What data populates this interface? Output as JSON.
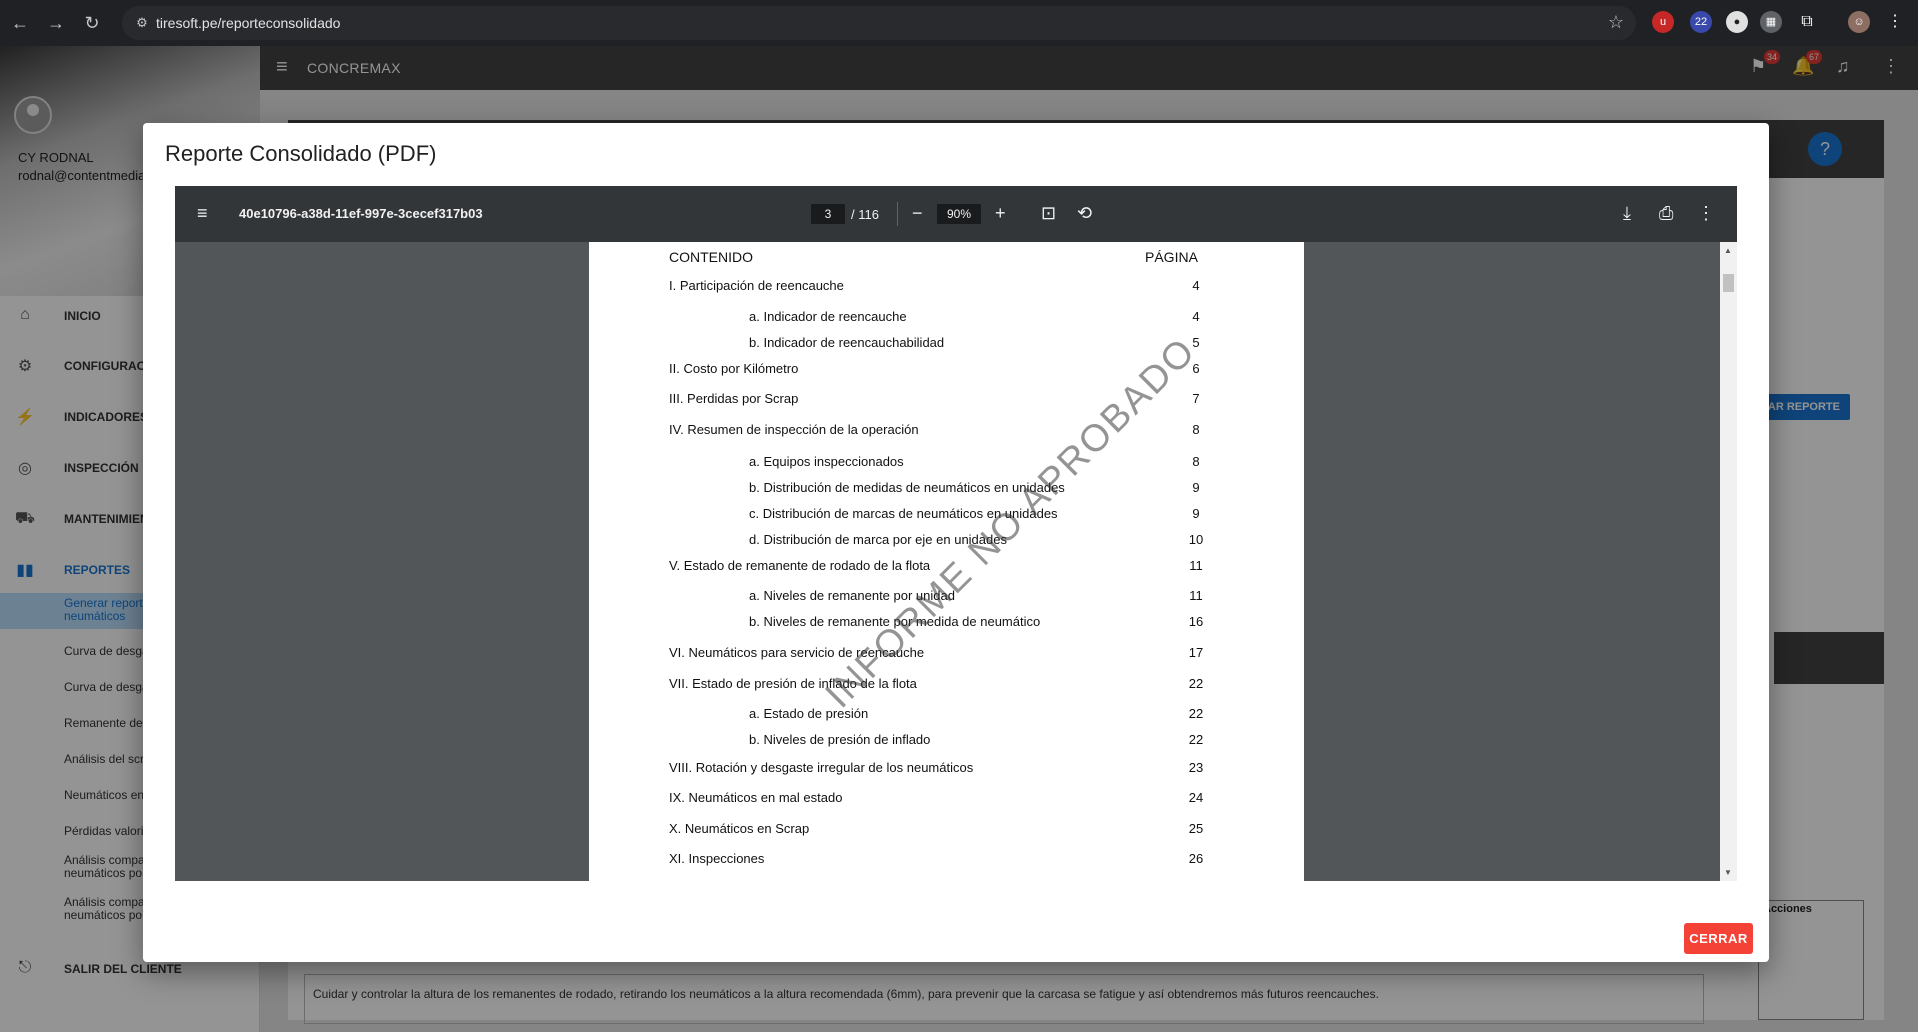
{
  "browser": {
    "url": "tiresoft.pe/reporteconsolidado",
    "ext_badges": {
      "notif_count": "22"
    }
  },
  "app": {
    "title": "CONCREMAX",
    "user": {
      "name": "CY RODNAL",
      "email": "rodnal@contentmedia."
    },
    "badges": {
      "flags": "34",
      "bell": "67"
    },
    "menu": [
      {
        "label": "INICIO",
        "icon": "home-icon"
      },
      {
        "label": "CONFIGURACIÓ",
        "icon": "gear-icon"
      },
      {
        "label": "INDICADORES",
        "icon": "indicators-icon"
      },
      {
        "label": "INSPECCIÓN",
        "icon": "inspection-icon"
      },
      {
        "label": "MANTENIMIEN",
        "icon": "maintenance-icon"
      },
      {
        "label": "REPORTES",
        "icon": "bar-chart-icon"
      }
    ],
    "submenu": [
      "Generar reporte\nneumáticos",
      "Curva de desga",
      "Curva de desga",
      "Remanente de",
      "Análisis del scr",
      "Neumáticos en",
      "Pérdidas valori",
      "Análisis compa\nneumáticos po",
      "Análisis compa\nneumáticos po"
    ],
    "exit_label": "SALIR DEL CLIENTE",
    "upload_label": "CARGAR REPORTE",
    "acciones_label": "Acciones",
    "note_text": "Cuidar y controlar la altura de los remanentes de rodado, retirando los neumáticos a la altura recomendada (6mm), para prevenir que la carcasa se fatigue y así obtendremos más futuros reencauches."
  },
  "modal": {
    "title": "Reporte Consolidado (PDF)",
    "close_label": "CERRAR"
  },
  "viewer": {
    "doc_name": "40e10796-a38d-11ef-997e-3cecef317b03",
    "current_page": "3",
    "total_pages": "/ 116",
    "zoom": "90%"
  },
  "toc": {
    "header_left": "CONTENIDO",
    "header_right": "PÁGINA",
    "watermark": "INFORME NO APROBADO",
    "entries": [
      {
        "title": "I. Participación de reencauche",
        "page": "4",
        "indent": false
      },
      {
        "title": "a. Indicador de reencauche",
        "page": "4",
        "indent": true
      },
      {
        "title": "b. Indicador de reencauchabilidad",
        "page": "5",
        "indent": true
      },
      {
        "title": "II. Costo por Kilómetro",
        "page": "6",
        "indent": false
      },
      {
        "title": "III. Perdidas por Scrap",
        "page": "7",
        "indent": false
      },
      {
        "title": "IV. Resumen de inspección de la operación",
        "page": "8",
        "indent": false
      },
      {
        "title": "a. Equipos inspeccionados",
        "page": "8",
        "indent": true
      },
      {
        "title": "b. Distribución de medidas de neumáticos en unidades",
        "page": "9",
        "indent": true
      },
      {
        "title": "c. Distribución de marcas de neumáticos en unidades",
        "page": "9",
        "indent": true
      },
      {
        "title": "d. Distribución de marca por eje en unidades",
        "page": "10",
        "indent": true
      },
      {
        "title": "V. Estado de remanente de rodado de la flota",
        "page": "11",
        "indent": false
      },
      {
        "title": "a. Niveles de remanente por unidad",
        "page": "11",
        "indent": true
      },
      {
        "title": "b. Niveles de remanente por medida de neumático",
        "page": "16",
        "indent": true
      },
      {
        "title": "VI. Neumáticos para servicio de reencauche",
        "page": "17",
        "indent": false
      },
      {
        "title": "VII. Estado de presión de inflado de la flota",
        "page": "22",
        "indent": false
      },
      {
        "title": "a. Estado de presión",
        "page": "22",
        "indent": true
      },
      {
        "title": "b. Niveles de presión de inflado",
        "page": "22",
        "indent": true
      },
      {
        "title": "VIII. Rotación y desgaste irregular de los neumáticos",
        "page": "23",
        "indent": false
      },
      {
        "title": "IX. Neumáticos en mal estado",
        "page": "24",
        "indent": false
      },
      {
        "title": "X. Neumáticos en Scrap",
        "page": "25",
        "indent": false
      },
      {
        "title": "XI. Inspecciones",
        "page": "26",
        "indent": false
      }
    ]
  }
}
